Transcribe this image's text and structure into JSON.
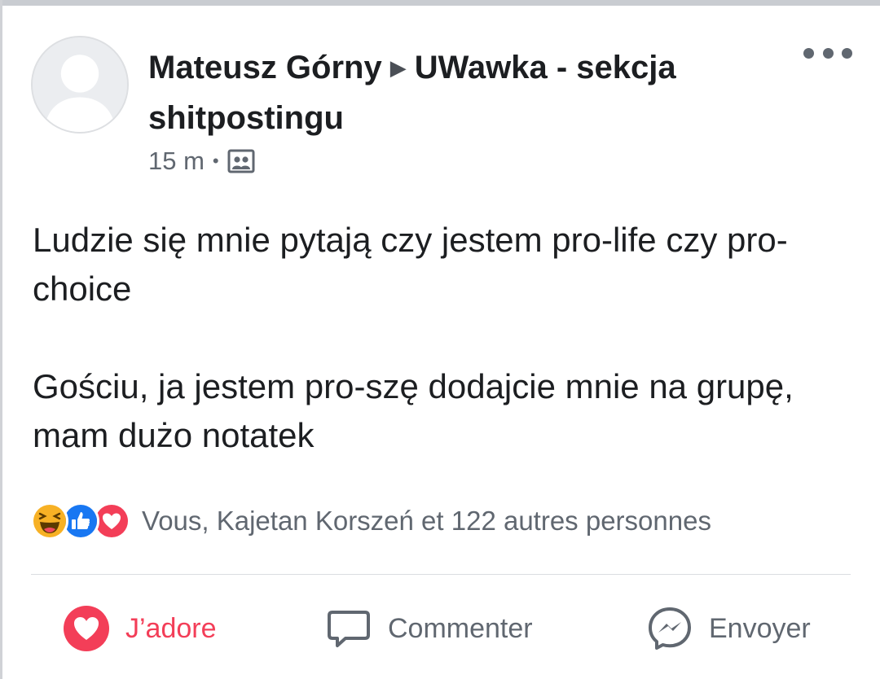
{
  "post": {
    "author": "Mateusz Górny",
    "separator_icon": "right-triangle-icon",
    "group": "UWawka - sekcja shitpostingu",
    "time": "15 m",
    "audience_icon": "group-icon",
    "more_icon": "more-dots-icon",
    "body": [
      "Ludzie się mnie pytają czy jestem pro-life czy pro-choice",
      "Gościu, ja jestem pro-szę dodajcie mnie na grupę, mam dużo notatek"
    ]
  },
  "reactions": {
    "icons": [
      "haha-icon",
      "like-icon",
      "love-icon"
    ],
    "summary": "Vous, Kajetan Korszeń et 122 autres personnes"
  },
  "actions": {
    "love_label": "J’adore",
    "comment_label": "Commenter",
    "send_label": "Envoyer"
  },
  "colors": {
    "love": "#f33e58",
    "like": "#1877f2",
    "haha": "#f7b125",
    "secondary_text": "#606770"
  }
}
